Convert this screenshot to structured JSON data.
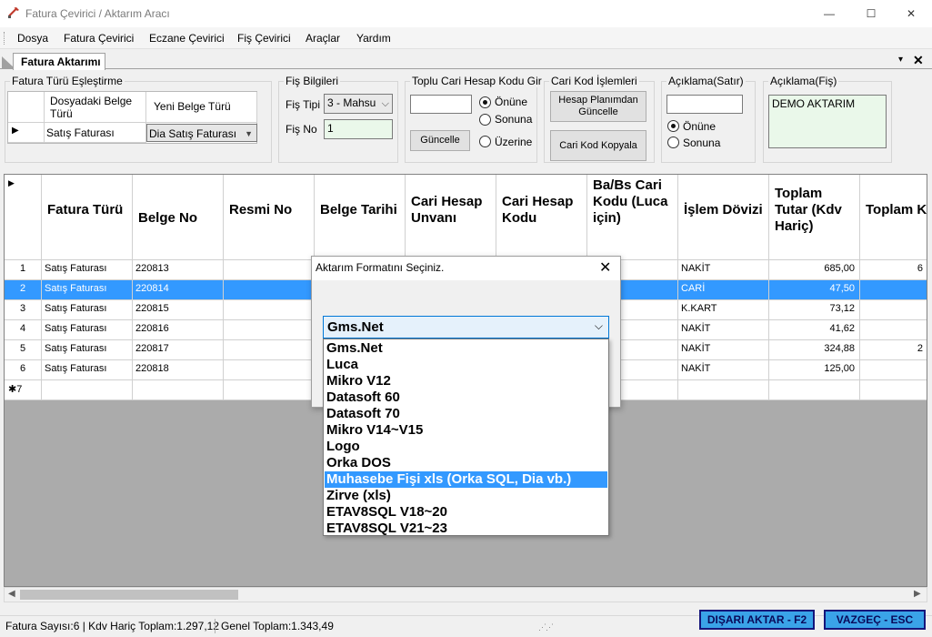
{
  "window": {
    "title": "Fatura Çevirici / Aktarım Aracı",
    "minimize_glyph": "—",
    "maximize_glyph": "☐",
    "close_glyph": "✕"
  },
  "menu": [
    "Dosya",
    "Fatura Çevirici",
    "Eczane Çevirici",
    "Fiş Çevirici",
    "Araçlar",
    "Yardım"
  ],
  "tab": {
    "label": "Fatura Aktarımı",
    "dropdown_glyph": "▾",
    "close_glyph": "✕"
  },
  "mapping": {
    "title": "Fatura Türü Eşleştirme",
    "col1_header": "Dosyadaki Belge Türü",
    "col2_header": "Yeni Belge Türü",
    "row_source": "Satış Faturası",
    "row_target": "Dia Satış Faturası"
  },
  "fis_bilgileri": {
    "title": "Fiş Bilgileri",
    "fis_tipi_label": "Fiş Tipi",
    "fis_tipi_value": "3 - Mahsu",
    "fis_no_label": "Fiş No",
    "fis_no_value": "1"
  },
  "toplu_cari": {
    "title": "Toplu Cari Hesap Kodu Gir",
    "input_value": "",
    "radios": [
      "Önüne",
      "Sonuna",
      "Üzerine"
    ],
    "selected": "Önüne",
    "update_button": "Güncelle"
  },
  "cari_kod": {
    "title": "Cari Kod İşlemleri",
    "button1": "Hesap Planımdan Güncelle",
    "button2": "Cari Kod Kopyala"
  },
  "aciklama_satir": {
    "title": "Açıklama(Satır)",
    "input_value": "",
    "radios": [
      "Önüne",
      "Sonuna"
    ],
    "selected": "Önüne"
  },
  "aciklama_fis": {
    "title": "Açıklama(Fiş)",
    "value": "DEMO AKTARIM"
  },
  "grid": {
    "headers": [
      "Fatura Türü",
      "Belge No",
      "Resmi No",
      "Belge Tarihi",
      "Cari Hesap Unvanı",
      "Cari Hesap Kodu",
      "Ba/Bs Cari Kodu (Luca için)",
      "İşlem Dövizi",
      "Toplam Tutar (Kdv Hariç)",
      "Toplam Kdv"
    ],
    "rows": [
      {
        "n": "1",
        "tur": "Satış Faturası",
        "belge": "220813",
        "doviz": "NAKİT",
        "tutar": "685,00",
        "kdv": "6"
      },
      {
        "n": "2",
        "tur": "Satış Faturası",
        "belge": "220814",
        "doviz": "CARİ",
        "tutar": "47,50",
        "kdv": ""
      },
      {
        "n": "3",
        "tur": "Satış Faturası",
        "belge": "220815",
        "doviz": "K.KART",
        "tutar": "73,12",
        "kdv": ""
      },
      {
        "n": "4",
        "tur": "Satış Faturası",
        "belge": "220816",
        "doviz": "NAKİT",
        "tutar": "41,62",
        "kdv": ""
      },
      {
        "n": "5",
        "tur": "Satış Faturası",
        "belge": "220817",
        "doviz": "NAKİT",
        "tutar": "324,88",
        "kdv": "2"
      },
      {
        "n": "6",
        "tur": "Satış Faturası",
        "belge": "220818",
        "doviz": "NAKİT",
        "tutar": "125,00",
        "kdv": ""
      }
    ],
    "new_row_label": "7",
    "selected_row": 1
  },
  "status": {
    "summary": "Fatura Sayısı:6 | Kdv Hariç Toplam:1.297,12",
    "total": "Genel Toplam:1.343,49",
    "export_button": "DIŞARI AKTAR - F2",
    "cancel_button": "VAZGEÇ - ESC"
  },
  "dialog": {
    "title": "Aktarım Formatını Seçiniz.",
    "selected_value": "Gms.Net",
    "options": [
      "Gms.Net",
      "Luca",
      "Mikro V12",
      "Datasoft 60",
      "Datasoft 70",
      "Mikro V14~V15",
      "Logo",
      "Orka DOS",
      "Muhasebe Fişi xls (Orka SQL, Dia vb.)",
      "Zirve (xls)",
      "ETAV8SQL V18~20",
      "ETAV8SQL V21~23"
    ],
    "highlighted_index": 8
  },
  "colors": {
    "selection": "#3399ff",
    "grid_bg": "#ababab",
    "action_button": "#3aa3e8"
  }
}
